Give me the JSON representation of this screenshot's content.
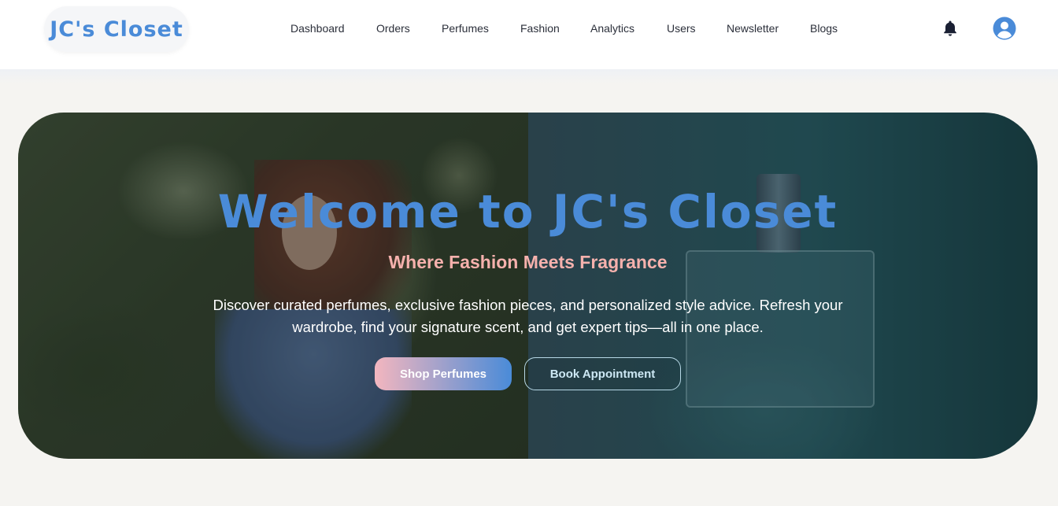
{
  "brand": {
    "name": "JC's Closet",
    "color": "#4a8bd8"
  },
  "nav": {
    "items": [
      {
        "label": "Dashboard"
      },
      {
        "label": "Orders"
      },
      {
        "label": "Perfumes"
      },
      {
        "label": "Fashion"
      },
      {
        "label": "Analytics"
      },
      {
        "label": "Users"
      },
      {
        "label": "Newsletter"
      },
      {
        "label": "Blogs"
      }
    ],
    "icons": [
      "bell-icon",
      "user-avatar-icon"
    ]
  },
  "hero": {
    "title": "Welcome to JC's Closet",
    "subtitle": "Where Fashion Meets Fragrance",
    "description": "Discover curated perfumes, exclusive fashion pieces, and personalized style advice. Refresh your wardrobe, find your signature scent, and get expert tips—all in one place.",
    "primary_button": "Shop Perfumes",
    "secondary_button": "Book Appointment"
  },
  "colors": {
    "accent": "#4a8bd8",
    "subtitle": "#f6b1ad",
    "page_background": "#f5f4f1"
  }
}
